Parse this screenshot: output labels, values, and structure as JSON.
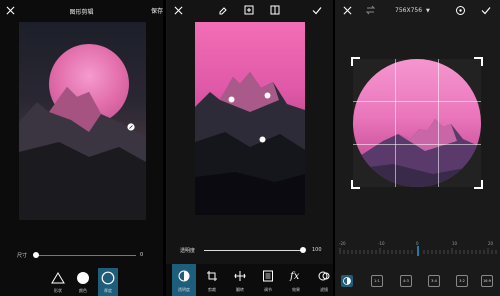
{
  "panel1": {
    "title": "图形剪辑",
    "save_label": "保存",
    "size_label": "尺寸",
    "size_value": "0",
    "shapes": [
      {
        "label": "形状"
      },
      {
        "label": "颜色"
      },
      {
        "label": "厚度"
      }
    ]
  },
  "panel2": {
    "opacity_label": "透明度",
    "opacity_value": "100",
    "tools": [
      {
        "label": "透明度"
      },
      {
        "label": "剪裁"
      },
      {
        "label": "翻转"
      },
      {
        "label": "调节"
      },
      {
        "label": "效果"
      },
      {
        "label": "滤镜"
      }
    ]
  },
  "panel3": {
    "dimensions": "756X756",
    "ruler": {
      "ticks": [
        "-20",
        "-10",
        "0",
        "10",
        "20"
      ]
    },
    "ratios": [
      "1:1",
      "4:3",
      "3:4",
      "3:2",
      "16:9"
    ]
  },
  "colors": {
    "accent": "#29a8d8",
    "pink": "#ef7dc2",
    "bg": "#000000"
  }
}
